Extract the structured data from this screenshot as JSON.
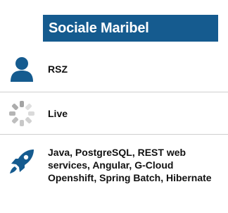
{
  "header": {
    "title": "Sociale Maribel",
    "color": "#155b8f"
  },
  "rows": [
    {
      "icon": "person-icon",
      "label": "RSZ",
      "icon_color": "#155b8f"
    },
    {
      "icon": "loading-spinner-icon",
      "label": "Live",
      "icon_color": "#9e9e9e"
    },
    {
      "icon": "rocket-icon",
      "label": "Java, PostgreSQL, REST web services, Angular, G-Cloud Openshift, Spring Batch, Hibernate",
      "icon_color": "#155b8f"
    }
  ]
}
